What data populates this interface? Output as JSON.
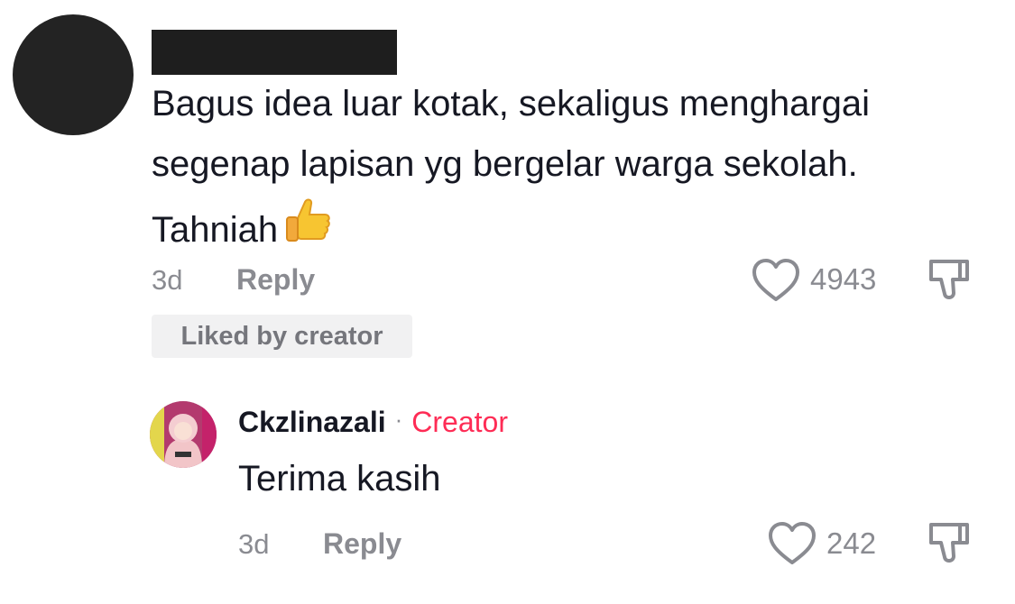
{
  "comment": {
    "text": "Bagus idea luar kotak, sekaligus menghargai segenap lapisan yg bergelar warga sekolah. Tahniah",
    "emoji": "thumbs-up-icon",
    "time": "3d",
    "reply_label": "Reply",
    "likes": "4943",
    "liked_by_creator": "Liked by creator"
  },
  "reply": {
    "username": "Ckzlinazali",
    "separator": "·",
    "creator_label": "Creator",
    "text": "Terima kasih",
    "time": "3d",
    "reply_label": "Reply",
    "likes": "242"
  },
  "colors": {
    "creator_accent": "#fe2c55",
    "meta_gray": "#8a8b91",
    "text_dark": "#161823",
    "badge_bg": "#f1f1f2"
  },
  "icons": [
    "heart-outline-icon",
    "dislike-icon",
    "thumbs-up-icon"
  ]
}
